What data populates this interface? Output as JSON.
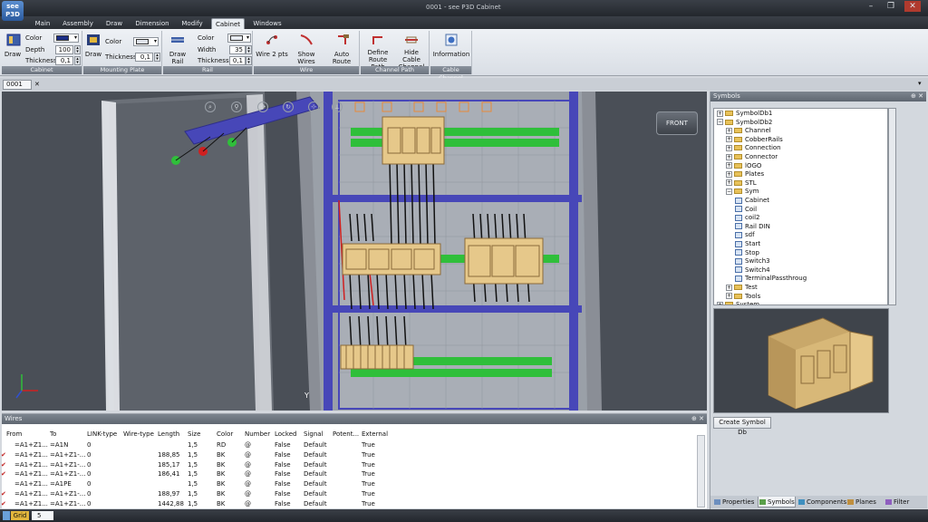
{
  "app": {
    "logo_top": "see",
    "logo_bottom": "P3D",
    "title": "0001 - see P3D Cabinet"
  },
  "window": {
    "minimize": "–",
    "maximize": "❐",
    "close": "✕"
  },
  "menu": {
    "tabs": [
      "Main",
      "Assembly",
      "Draw",
      "Dimension",
      "Modify",
      "Cabinet",
      "Windows"
    ],
    "active": "Cabinet"
  },
  "ribbon": {
    "cabinet": {
      "title": "Cabinet",
      "draw": "Draw",
      "color_label": "Color",
      "color": "#1c2f86",
      "depth_label": "Depth",
      "depth": "100",
      "thickness_label": "Thickness",
      "thickness": "0,1"
    },
    "mounting_plate": {
      "title": "Mounting Plate",
      "draw": "Draw",
      "color_label": "Color",
      "color": "#dfe3ea",
      "thickness_label": "Thickness",
      "thickness": "0,1"
    },
    "rail": {
      "title": "Rail",
      "draw": "Draw Rail",
      "color_label": "Color",
      "color": "#e8ecf2",
      "width_label": "Width",
      "width": "35",
      "thickness_label": "Thickness",
      "thickness": "0,1"
    },
    "wire": {
      "title": "Wire",
      "buttons": [
        "Wire 2 pts",
        "Show Wires",
        "Auto Route"
      ]
    },
    "channel_path": {
      "title": "Channel Path",
      "buttons": [
        "Define Route Path",
        "Hide Cable Channel"
      ]
    },
    "cable_channel": {
      "title": "Cable Channel",
      "buttons": [
        "Information"
      ]
    }
  },
  "doc_tab": {
    "label": "0001",
    "close": "✕"
  },
  "viewport": {
    "cube_label": "FRONT",
    "axis_label": "Y",
    "accent_green": "#2fbf3a",
    "cabinet_blue": "#4747b8"
  },
  "symbols": {
    "title": "Symbols",
    "tree": [
      {
        "label": "SymbolDb1",
        "level": 0,
        "exp": "+",
        "kind": "db"
      },
      {
        "label": "SymbolDb2",
        "level": 0,
        "exp": "−",
        "kind": "db"
      },
      {
        "label": "Channel",
        "level": 1,
        "exp": "+",
        "kind": "folder"
      },
      {
        "label": "CobberRails",
        "level": 1,
        "exp": "+",
        "kind": "folder"
      },
      {
        "label": "Connection",
        "level": 1,
        "exp": "+",
        "kind": "folder"
      },
      {
        "label": "Connector",
        "level": 1,
        "exp": "+",
        "kind": "folder"
      },
      {
        "label": "lOGO",
        "level": 1,
        "exp": "+",
        "kind": "folder"
      },
      {
        "label": "Plates",
        "level": 1,
        "exp": "+",
        "kind": "folder"
      },
      {
        "label": "STL",
        "level": 1,
        "exp": "+",
        "kind": "folder"
      },
      {
        "label": "Sym",
        "level": 1,
        "exp": "−",
        "kind": "folder"
      },
      {
        "label": "Cabinet",
        "level": 2,
        "exp": "",
        "kind": "sym"
      },
      {
        "label": "Coil",
        "level": 2,
        "exp": "",
        "kind": "sym"
      },
      {
        "label": "coil2",
        "level": 2,
        "exp": "",
        "kind": "sym"
      },
      {
        "label": "Rail DIN",
        "level": 2,
        "exp": "",
        "kind": "sym"
      },
      {
        "label": "sdf",
        "level": 2,
        "exp": "",
        "kind": "sym"
      },
      {
        "label": "Start",
        "level": 2,
        "exp": "",
        "kind": "sym"
      },
      {
        "label": "Stop",
        "level": 2,
        "exp": "",
        "kind": "sym"
      },
      {
        "label": "Switch3",
        "level": 2,
        "exp": "",
        "kind": "sym"
      },
      {
        "label": "Switch4",
        "level": 2,
        "exp": "",
        "kind": "sym"
      },
      {
        "label": "TerminalPassthroug",
        "level": 2,
        "exp": "",
        "kind": "sym"
      },
      {
        "label": "Test",
        "level": 1,
        "exp": "+",
        "kind": "folder"
      },
      {
        "label": "Tools",
        "level": 1,
        "exp": "+",
        "kind": "folder"
      },
      {
        "label": "System",
        "level": 0,
        "exp": "+",
        "kind": "db"
      }
    ],
    "create_button": "Create Symbol Db",
    "bottom_tabs": [
      "Properties",
      "Symbols",
      "Components",
      "Planes",
      "Filter"
    ],
    "active_tab": "Symbols"
  },
  "wires": {
    "title": "Wires",
    "columns": [
      "From",
      "To",
      "LINK-type",
      "Wire-type",
      "Length",
      "Size",
      "Color",
      "Number",
      "Locked",
      "Signal",
      "Potent...",
      "External"
    ],
    "rows": [
      {
        "check": "",
        "cells": [
          "=A1+Z1...",
          "=A1N",
          "0",
          "",
          "",
          "1,5",
          "RD",
          "@",
          "False",
          "Default",
          "",
          "True"
        ]
      },
      {
        "check": "✔",
        "cells": [
          "=A1+Z1...",
          "=A1+Z1-...",
          "0",
          "",
          "188,85",
          "1,5",
          "BK",
          "@",
          "False",
          "Default",
          "",
          "True"
        ]
      },
      {
        "check": "✔",
        "cells": [
          "=A1+Z1...",
          "=A1+Z1-...",
          "0",
          "",
          "185,17",
          "1,5",
          "BK",
          "@",
          "False",
          "Default",
          "",
          "True"
        ]
      },
      {
        "check": "✔",
        "cells": [
          "=A1+Z1...",
          "=A1+Z1-...",
          "0",
          "",
          "186,41",
          "1,5",
          "BK",
          "@",
          "False",
          "Default",
          "",
          "True"
        ]
      },
      {
        "check": "",
        "cells": [
          "=A1+Z1...",
          "=A1PE",
          "0",
          "",
          "",
          "1,5",
          "BK",
          "@",
          "False",
          "Default",
          "",
          "True"
        ]
      },
      {
        "check": "✔",
        "cells": [
          "=A1+Z1...",
          "=A1+Z1-...",
          "0",
          "",
          "188,97",
          "1,5",
          "BK",
          "@",
          "False",
          "Default",
          "",
          "True"
        ]
      },
      {
        "check": "✔",
        "cells": [
          "=A1+Z1...",
          "=A1+Z1-...",
          "0",
          "",
          "1442,88",
          "1,5",
          "BK",
          "@",
          "False",
          "Default",
          "",
          "True"
        ]
      }
    ]
  },
  "statusbar": {
    "grid_label": "Grid",
    "grid_value": "5"
  }
}
